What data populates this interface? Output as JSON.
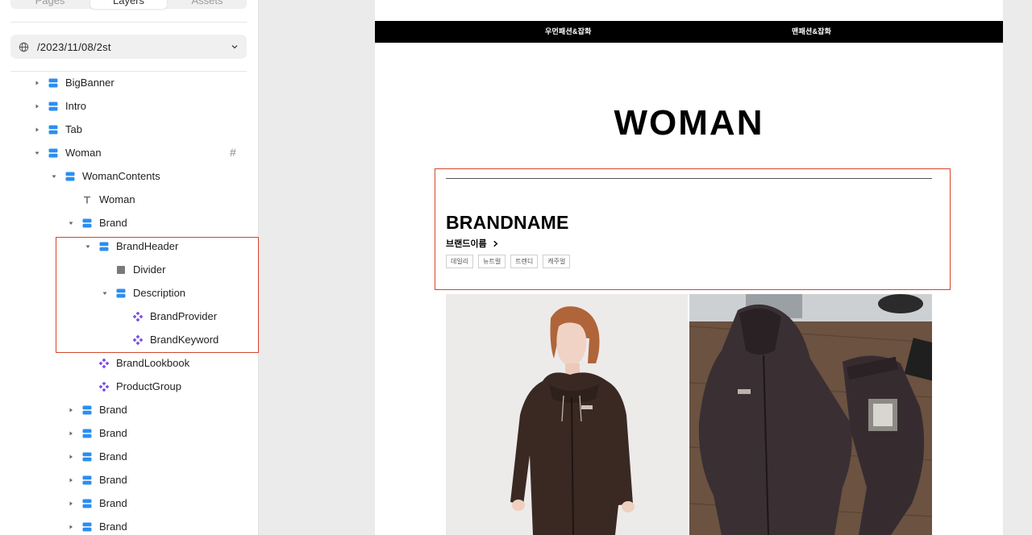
{
  "panel": {
    "tabs": [
      "Pages",
      "Layers",
      "Assets"
    ],
    "page_selector": "/2023/11/08/2st"
  },
  "layers": [
    {
      "label": "BigBanner",
      "type": "stack",
      "caret": "right"
    },
    {
      "label": "Intro",
      "type": "stack",
      "caret": "right"
    },
    {
      "label": "Tab",
      "type": "stack",
      "caret": "right"
    },
    {
      "label": "Woman",
      "type": "stack",
      "caret": "down",
      "badge": "#"
    },
    {
      "label": "WomanContents",
      "type": "stack",
      "caret": "down"
    },
    {
      "label": "Woman",
      "type": "text",
      "caret": ""
    },
    {
      "label": "Brand",
      "type": "stack",
      "caret": "down"
    },
    {
      "label": "BrandHeader",
      "type": "stack",
      "caret": "down"
    },
    {
      "label": "Divider",
      "type": "rect",
      "caret": ""
    },
    {
      "label": "Description",
      "type": "stack",
      "caret": "down"
    },
    {
      "label": "BrandProvider",
      "type": "component",
      "caret": ""
    },
    {
      "label": "BrandKeyword",
      "type": "component",
      "caret": ""
    },
    {
      "label": "BrandLookbook",
      "type": "component",
      "caret": ""
    },
    {
      "label": "ProductGroup",
      "type": "component",
      "caret": ""
    },
    {
      "label": "Brand",
      "type": "stack",
      "caret": "right"
    },
    {
      "label": "Brand",
      "type": "stack",
      "caret": "right"
    },
    {
      "label": "Brand",
      "type": "stack",
      "caret": "right"
    },
    {
      "label": "Brand",
      "type": "stack",
      "caret": "right"
    },
    {
      "label": "Brand",
      "type": "stack",
      "caret": "right"
    },
    {
      "label": "Brand",
      "type": "stack",
      "caret": "right"
    }
  ],
  "canvas": {
    "nav": [
      "우먼패션&잡화",
      "맨패션&잡화"
    ],
    "title": "WOMAN",
    "brand": {
      "name": "BRANDNAME",
      "provider": "브랜드이름",
      "keywords": [
        "데일리",
        "뉴트럴",
        "트렌디",
        "캐주얼"
      ]
    }
  },
  "colors": {
    "selection": "#d6452e",
    "stack_icon": "#2c8ef0",
    "component_icon": "#7b4fe0",
    "navbar": "#000000"
  }
}
